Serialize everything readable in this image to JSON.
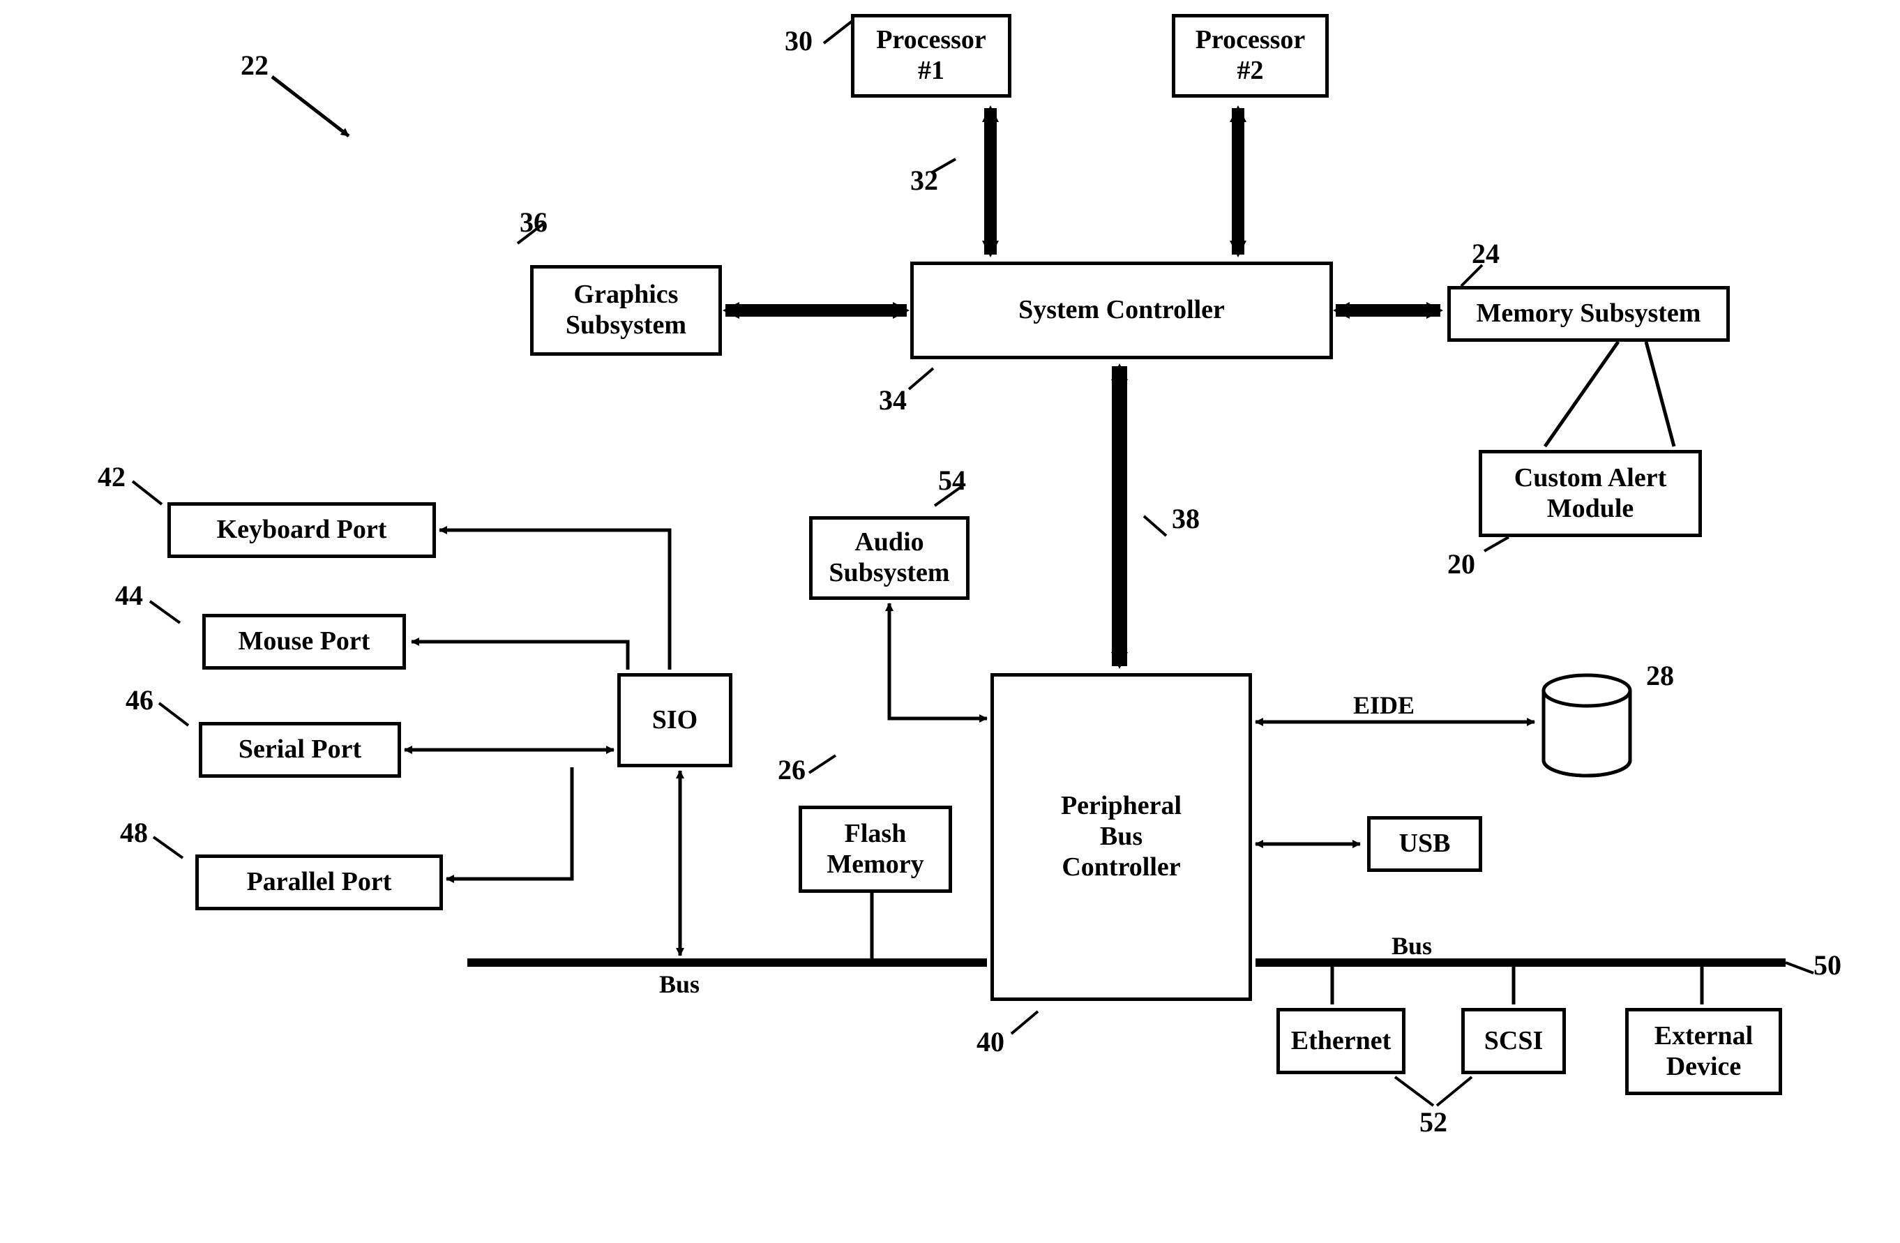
{
  "boxes": {
    "processor1": "Processor\n#1",
    "processor2": "Processor\n#2",
    "graphics": "Graphics\nSubsystem",
    "system_controller": "System Controller",
    "memory_subsystem": "Memory Subsystem",
    "custom_alert": "Custom Alert\nModule",
    "audio": "Audio\nSubsystem",
    "sio": "SIO",
    "keyboard": "Keyboard Port",
    "mouse": "Mouse Port",
    "serial": "Serial Port",
    "parallel": "Parallel Port",
    "flash": "Flash\nMemory",
    "pbc": "Peripheral\nBus\nController",
    "usb": "USB",
    "ethernet": "Ethernet",
    "scsi": "SCSI",
    "ext_device": "External\nDevice"
  },
  "numbers": {
    "n22": "22",
    "n30": "30",
    "n36": "36",
    "n24": "24",
    "n32": "32",
    "n34": "34",
    "n38": "38",
    "n20": "20",
    "n42": "42",
    "n44": "44",
    "n46": "46",
    "n48": "48",
    "n54": "54",
    "n26": "26",
    "n40": "40",
    "n28": "28",
    "n50": "50",
    "n52": "52"
  },
  "labels": {
    "bus_left": "Bus",
    "bus_right": "Bus",
    "eide": "EIDE"
  }
}
